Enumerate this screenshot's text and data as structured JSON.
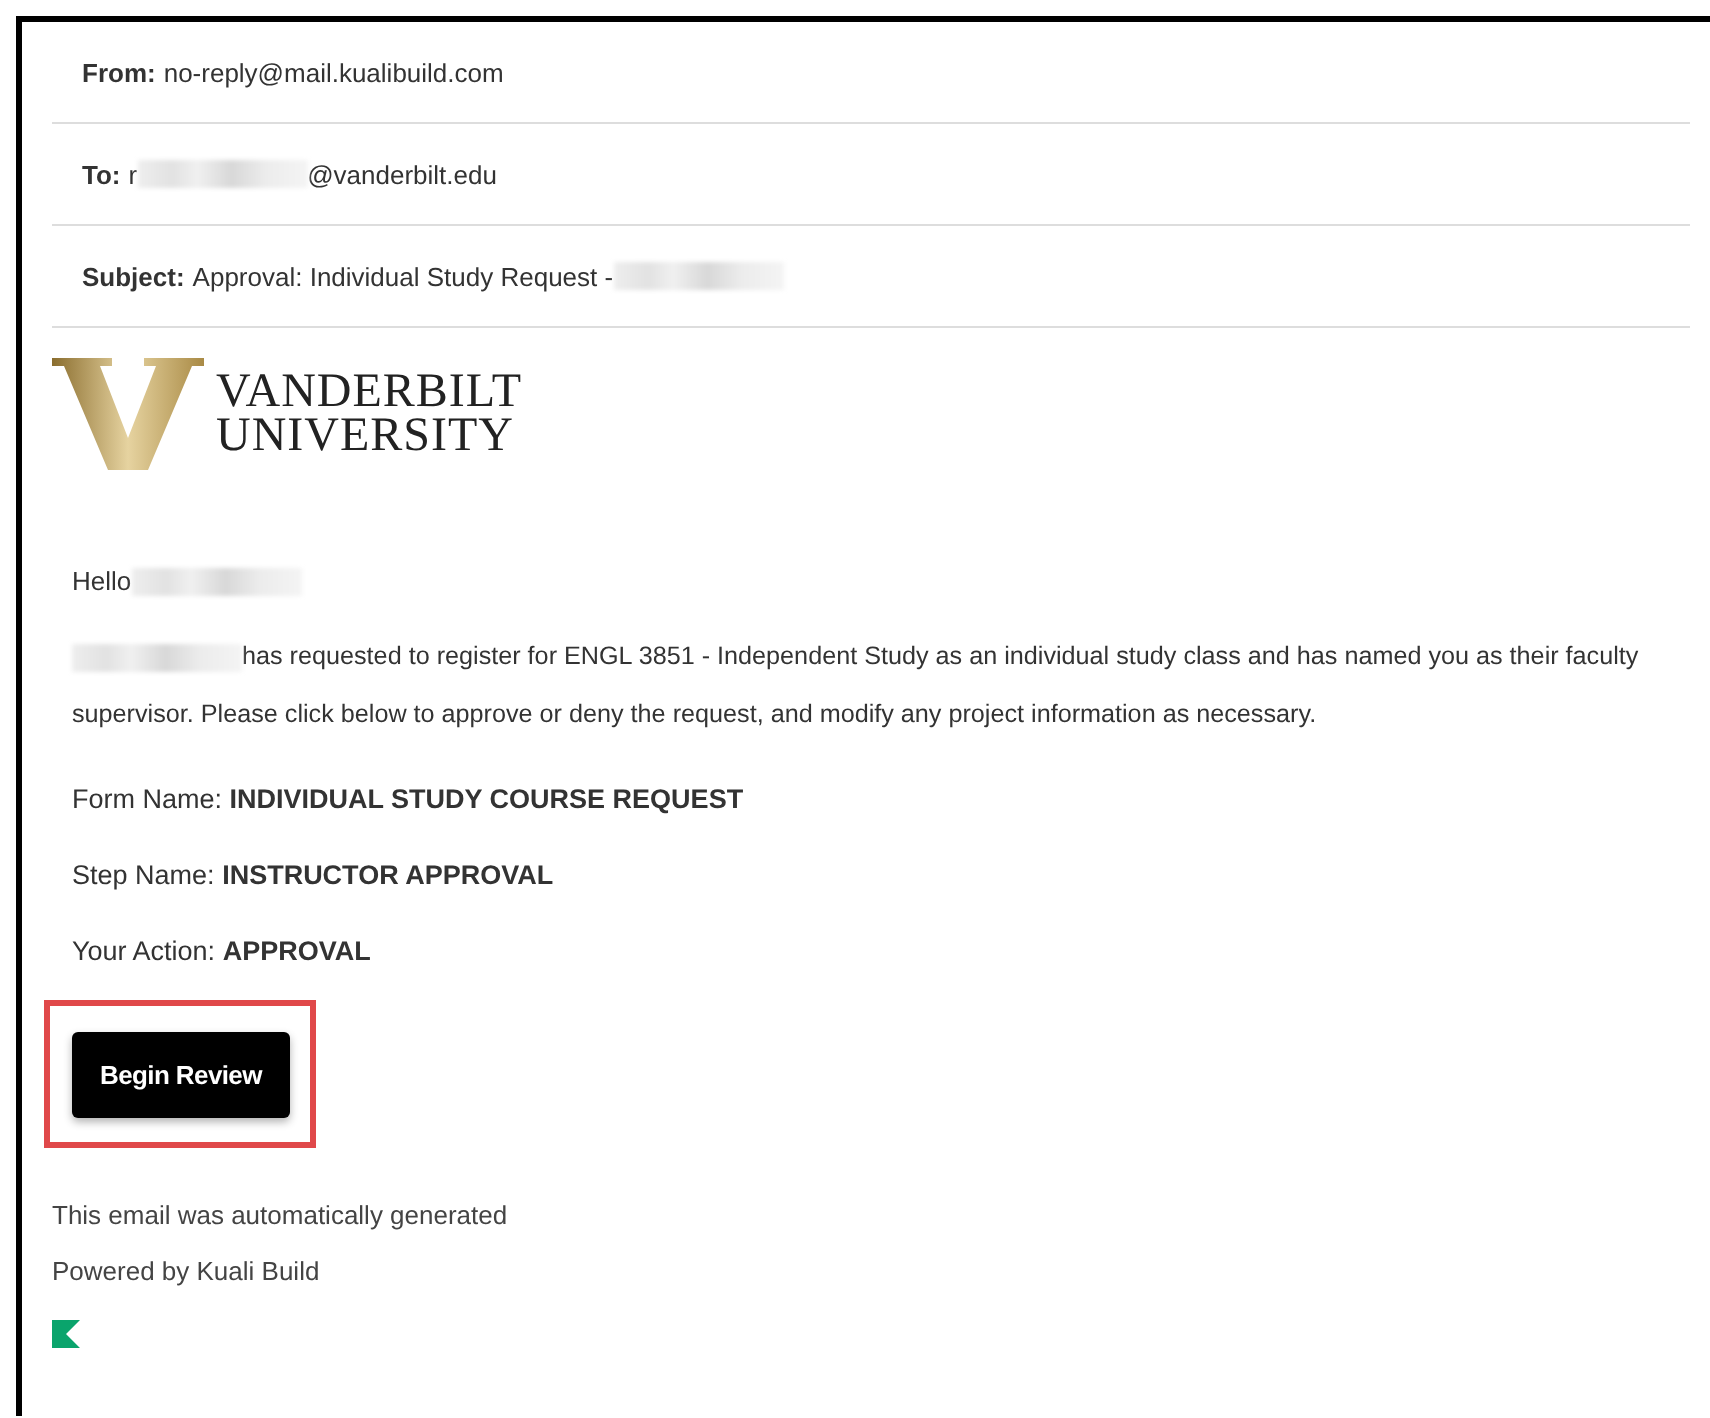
{
  "headers": [
    {
      "label": "From:",
      "parts": [
        {
          "kind": "text",
          "text": "no-reply@mail.kualibuild.com"
        }
      ]
    },
    {
      "label": "To:",
      "parts": [
        {
          "kind": "text",
          "text": "r"
        },
        {
          "kind": "redacted"
        },
        {
          "kind": "text",
          "text": "@vanderbilt.edu"
        }
      ]
    },
    {
      "label": "Subject:",
      "parts": [
        {
          "kind": "text",
          "text": "Approval: Individual Study Request -"
        },
        {
          "kind": "redacted"
        }
      ]
    }
  ],
  "logo": {
    "lines": [
      "VANDERBILT",
      "UNIVERSITY"
    ]
  },
  "greeting": [
    {
      "kind": "text",
      "text": "Hello"
    },
    {
      "kind": "redacted"
    }
  ],
  "message": [
    {
      "kind": "redacted"
    },
    {
      "kind": "text",
      "text": "has requested to register for ENGL 3851 - Independent Study as an individual study class and has named you as their faculty supervisor. Please click below to approve or deny the request, and modify any project information as necessary."
    }
  ],
  "details": [
    {
      "label": "Form Name:",
      "value": "INDIVIDUAL STUDY COURSE REQUEST"
    },
    {
      "label": "Step Name:",
      "value": "INSTRUCTOR APPROVAL"
    },
    {
      "label": "Your Action:",
      "value": "APPROVAL"
    }
  ],
  "button": {
    "label": "Begin Review",
    "highlighted": true
  },
  "footer": [
    "This email was automatically generated",
    "Powered by Kuali Build"
  ]
}
